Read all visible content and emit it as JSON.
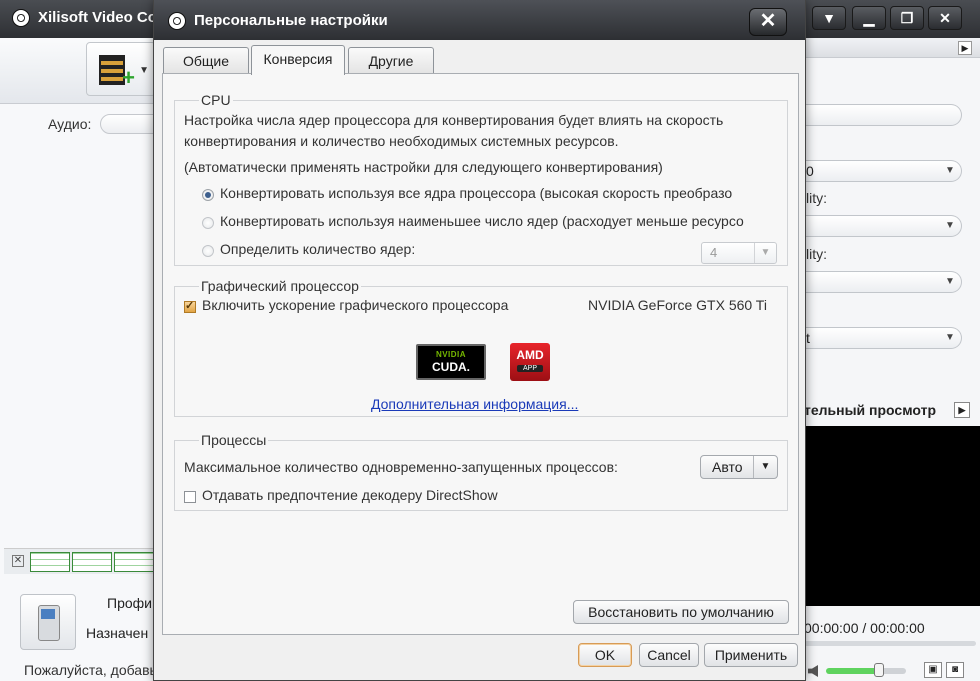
{
  "main_window": {
    "title": "Xilisoft Video Co",
    "controls": [
      "▼",
      "❐",
      "✕"
    ],
    "audio_label": "Аудио:",
    "profile_label": "Профи",
    "destination_label": "Назначен",
    "status_text": "Пожалуйста, добавьте файлы",
    "right_panel": {
      "field_1": "0",
      "label_1": "lity:",
      "label_2": "lity:",
      "field_4": "t",
      "preview_label": "тельный просмотр",
      "timecode": "00:00:00 / 00:00:00",
      "volume_fraction": 0.6
    }
  },
  "dialog": {
    "title": "Персональные настройки",
    "close": "✕",
    "tabs": [
      {
        "label": "Общие",
        "active": false
      },
      {
        "label": "Конверсия",
        "active": true
      },
      {
        "label": "Другие",
        "active": false
      }
    ],
    "cpu": {
      "title": "CPU",
      "description_line1": "Настройка числа ядер процессора для конвертирования будет влиять на скорость",
      "description_line2": "конвертирования и количество необходимых системных ресурсов.",
      "note": "(Автоматически применять настройки для следующего конвертирования)",
      "options": [
        {
          "label": "Конвертировать используя все ядра процессора (высокая скорость преобразо",
          "selected": true
        },
        {
          "label": "Конвертировать используя наименьшее число ядер (расходует меньше ресурсо",
          "selected": false
        },
        {
          "label": "Определить количество ядер:",
          "selected": false
        }
      ],
      "cores_value": "4"
    },
    "gpu": {
      "title": "Графический процессор",
      "enable_label": "Включить ускорение графического процессора",
      "enabled": true,
      "device": "NVIDIA GeForce GTX 560 Ti",
      "nvidia_brand": "NVIDIA",
      "nvidia_tech": "CUDA.",
      "amd_brand": "AMD",
      "amd_tech": "APP",
      "more_info": "Дополнительная информация..."
    },
    "processes": {
      "title": "Процессы",
      "max_label": "Максимальное количество одновременно-запущенных процессов:",
      "max_value": "Авто",
      "directshow_label": "Отдавать предпочтение декодеру DirectShow",
      "directshow_checked": false
    },
    "restore_button": "Восстановить по умолчанию",
    "ok_button": "OK",
    "cancel_button": "Cancel",
    "apply_button": "Применить"
  }
}
